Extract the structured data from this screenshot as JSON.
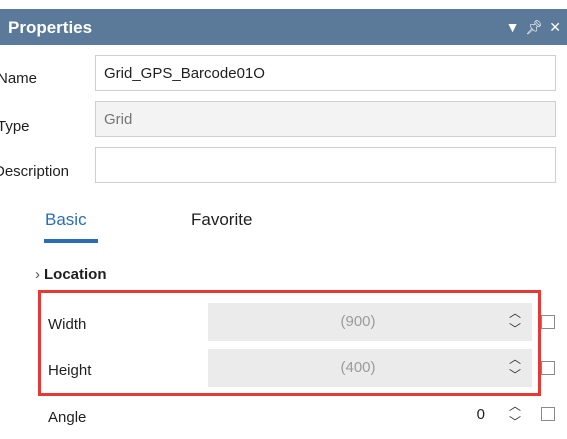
{
  "panel": {
    "title": "Properties",
    "icons": [
      "dropdown-arrow-icon",
      "pin-icon",
      "close-icon"
    ]
  },
  "fields": {
    "name_label": "Name",
    "name_value": "Grid_GPS_Barcode01O",
    "type_label": "Type",
    "type_placeholder": "Grid",
    "description_label": "Description",
    "description_value": ""
  },
  "tabs": [
    {
      "label": "Basic",
      "active": true
    },
    {
      "label": "Favorite",
      "active": false
    }
  ],
  "section": {
    "label": "Location"
  },
  "properties": [
    {
      "label": "Width",
      "value": "(900)"
    },
    {
      "label": "Height",
      "value": "(400)"
    },
    {
      "label": "Angle",
      "value": "0"
    }
  ],
  "colors": {
    "titlebar": "#5b7a99",
    "accent": "#2a6db5",
    "highlight": "#e53935"
  }
}
